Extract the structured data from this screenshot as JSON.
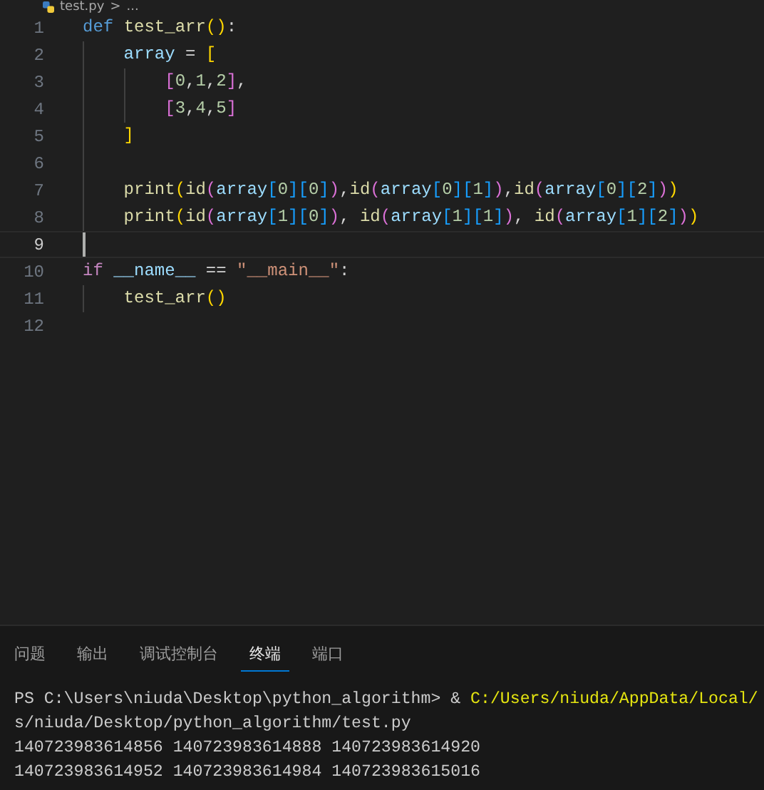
{
  "breadcrumb": {
    "file": "test.py",
    "separator": ">",
    "rest": "..."
  },
  "editor": {
    "lines": [
      {
        "number": "1",
        "current": false,
        "tokens": [
          {
            "text": "def ",
            "kind": "keyword"
          },
          {
            "text": "test_arr",
            "kind": "function"
          },
          {
            "text": "()",
            "kind": "bracket1"
          },
          {
            "text": ":",
            "kind": "plain"
          }
        ]
      },
      {
        "number": "2",
        "current": false,
        "tokens": [
          {
            "text": "    array",
            "kind": "variable"
          },
          {
            "text": " = ",
            "kind": "plain"
          },
          {
            "text": "[",
            "kind": "bracket1"
          }
        ]
      },
      {
        "number": "3",
        "current": false,
        "tokens": [
          {
            "text": "        [",
            "kind": "bracket2"
          },
          {
            "text": "0",
            "kind": "number"
          },
          {
            "text": ",",
            "kind": "plain"
          },
          {
            "text": "1",
            "kind": "number"
          },
          {
            "text": ",",
            "kind": "plain"
          },
          {
            "text": "2",
            "kind": "number"
          },
          {
            "text": "]",
            "kind": "bracket2"
          },
          {
            "text": ",",
            "kind": "plain"
          }
        ]
      },
      {
        "number": "4",
        "current": false,
        "tokens": [
          {
            "text": "        [",
            "kind": "bracket2"
          },
          {
            "text": "3",
            "kind": "number"
          },
          {
            "text": ",",
            "kind": "plain"
          },
          {
            "text": "4",
            "kind": "number"
          },
          {
            "text": ",",
            "kind": "plain"
          },
          {
            "text": "5",
            "kind": "number"
          },
          {
            "text": "]",
            "kind": "bracket2"
          }
        ]
      },
      {
        "number": "5",
        "current": false,
        "tokens": [
          {
            "text": "    ]",
            "kind": "bracket1"
          }
        ]
      },
      {
        "number": "6",
        "current": false
      },
      {
        "number": "7",
        "current": false,
        "tokens": [
          {
            "text": "    print",
            "kind": "function"
          },
          {
            "text": "(",
            "kind": "bracket1"
          },
          {
            "text": "id",
            "kind": "function"
          },
          {
            "text": "(",
            "kind": "bracket2"
          },
          {
            "text": "array",
            "kind": "variable"
          },
          {
            "text": "[",
            "kind": "bracket3"
          },
          {
            "text": "0",
            "kind": "number"
          },
          {
            "text": "][",
            "kind": "bracket3"
          },
          {
            "text": "0",
            "kind": "number"
          },
          {
            "text": "]",
            "kind": "bracket3"
          },
          {
            "text": ")",
            "kind": "bracket2"
          },
          {
            "text": ",",
            "kind": "plain"
          },
          {
            "text": "id",
            "kind": "function"
          },
          {
            "text": "(",
            "kind": "bracket2"
          },
          {
            "text": "array",
            "kind": "variable"
          },
          {
            "text": "[",
            "kind": "bracket3"
          },
          {
            "text": "0",
            "kind": "number"
          },
          {
            "text": "][",
            "kind": "bracket3"
          },
          {
            "text": "1",
            "kind": "number"
          },
          {
            "text": "]",
            "kind": "bracket3"
          },
          {
            "text": ")",
            "kind": "bracket2"
          },
          {
            "text": ",",
            "kind": "plain"
          },
          {
            "text": "id",
            "kind": "function"
          },
          {
            "text": "(",
            "kind": "bracket2"
          },
          {
            "text": "array",
            "kind": "variable"
          },
          {
            "text": "[",
            "kind": "bracket3"
          },
          {
            "text": "0",
            "kind": "number"
          },
          {
            "text": "][",
            "kind": "bracket3"
          },
          {
            "text": "2",
            "kind": "number"
          },
          {
            "text": "]",
            "kind": "bracket3"
          },
          {
            "text": ")",
            "kind": "bracket2"
          },
          {
            "text": ")",
            "kind": "bracket1"
          }
        ]
      },
      {
        "number": "8",
        "current": false,
        "tokens": [
          {
            "text": "    print",
            "kind": "function"
          },
          {
            "text": "(",
            "kind": "bracket1"
          },
          {
            "text": "id",
            "kind": "function"
          },
          {
            "text": "(",
            "kind": "bracket2"
          },
          {
            "text": "array",
            "kind": "variable"
          },
          {
            "text": "[",
            "kind": "bracket3"
          },
          {
            "text": "1",
            "kind": "number"
          },
          {
            "text": "][",
            "kind": "bracket3"
          },
          {
            "text": "0",
            "kind": "number"
          },
          {
            "text": "]",
            "kind": "bracket3"
          },
          {
            "text": ")",
            "kind": "bracket2"
          },
          {
            "text": ", ",
            "kind": "plain"
          },
          {
            "text": "id",
            "kind": "function"
          },
          {
            "text": "(",
            "kind": "bracket2"
          },
          {
            "text": "array",
            "kind": "variable"
          },
          {
            "text": "[",
            "kind": "bracket3"
          },
          {
            "text": "1",
            "kind": "number"
          },
          {
            "text": "][",
            "kind": "bracket3"
          },
          {
            "text": "1",
            "kind": "number"
          },
          {
            "text": "]",
            "kind": "bracket3"
          },
          {
            "text": ")",
            "kind": "bracket2"
          },
          {
            "text": ", ",
            "kind": "plain"
          },
          {
            "text": "id",
            "kind": "function"
          },
          {
            "text": "(",
            "kind": "bracket2"
          },
          {
            "text": "array",
            "kind": "variable"
          },
          {
            "text": "[",
            "kind": "bracket3"
          },
          {
            "text": "1",
            "kind": "number"
          },
          {
            "text": "][",
            "kind": "bracket3"
          },
          {
            "text": "2",
            "kind": "number"
          },
          {
            "text": "]",
            "kind": "bracket3"
          },
          {
            "text": ")",
            "kind": "bracket2"
          },
          {
            "text": ")",
            "kind": "bracket1"
          }
        ]
      },
      {
        "number": "9",
        "current": true
      },
      {
        "number": "10",
        "current": false,
        "tokens": [
          {
            "text": "if ",
            "kind": "control"
          },
          {
            "text": "__name__",
            "kind": "variable"
          },
          {
            "text": " == ",
            "kind": "plain"
          },
          {
            "text": "\"__main__\"",
            "kind": "string"
          },
          {
            "text": ":",
            "kind": "plain"
          }
        ]
      },
      {
        "number": "11",
        "current": false,
        "tokens": [
          {
            "text": "    test_arr",
            "kind": "function"
          },
          {
            "text": "()",
            "kind": "bracket1"
          }
        ]
      },
      {
        "number": "12",
        "current": false
      }
    ]
  },
  "panel": {
    "tabs": [
      {
        "label": "问题",
        "selected": false
      },
      {
        "label": "输出",
        "selected": false
      },
      {
        "label": "调试控制台",
        "selected": false
      },
      {
        "label": "终端",
        "selected": true
      },
      {
        "label": "端口",
        "selected": false
      }
    ],
    "terminal_lines": [
      [
        {
          "text": "PS C:\\Users\\niuda\\Desktop\\python_algorithm> & ",
          "kind": "plain"
        },
        {
          "text": "C:/Users/niuda/AppData/Local/",
          "kind": "path"
        }
      ],
      [
        {
          "text": "s/niuda/Desktop/python_algorithm/test.py",
          "kind": "plain"
        }
      ],
      [
        {
          "text": "140723983614856 140723983614888 140723983614920",
          "kind": "plain"
        }
      ],
      [
        {
          "text": "140723983614952 140723983614984 140723983615016",
          "kind": "plain"
        }
      ]
    ]
  }
}
